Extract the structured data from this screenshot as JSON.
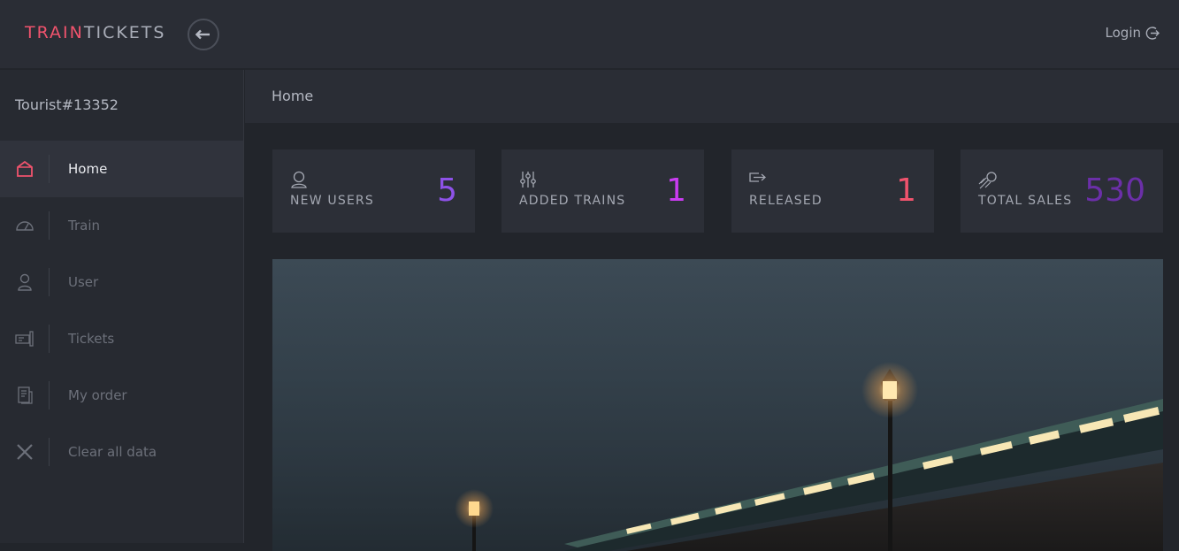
{
  "brand": {
    "part1": "TRAIN",
    "part2": "TICKETS"
  },
  "header": {
    "login_label": "Login"
  },
  "sidebar": {
    "username": "Tourist#13352",
    "items": [
      {
        "label": "Home",
        "icon": "home-icon"
      },
      {
        "label": "Train",
        "icon": "gauge-icon"
      },
      {
        "label": "User",
        "icon": "user-icon"
      },
      {
        "label": "Tickets",
        "icon": "ticket-icon"
      },
      {
        "label": "My order",
        "icon": "order-icon"
      },
      {
        "label": "Clear all data",
        "icon": "close-icon"
      }
    ]
  },
  "breadcrumb": {
    "title": "Home"
  },
  "stats": [
    {
      "label": "NEW USERS",
      "value": "5",
      "color": "#8e52e8",
      "icon": "user-icon"
    },
    {
      "label": "ADDED TRAINS",
      "value": "1",
      "color": "#c93cf0",
      "icon": "sliders-icon"
    },
    {
      "label": "RELEASED",
      "value": "1",
      "color": "#f0536d",
      "icon": "export-icon"
    },
    {
      "label": "TOTAL SALES",
      "value": "530",
      "color": "#6b2fa8",
      "icon": "rocket-icon"
    }
  ],
  "colors": {
    "accent": "#f0536d",
    "background": "#22252b",
    "panel": "#2a2d35"
  }
}
